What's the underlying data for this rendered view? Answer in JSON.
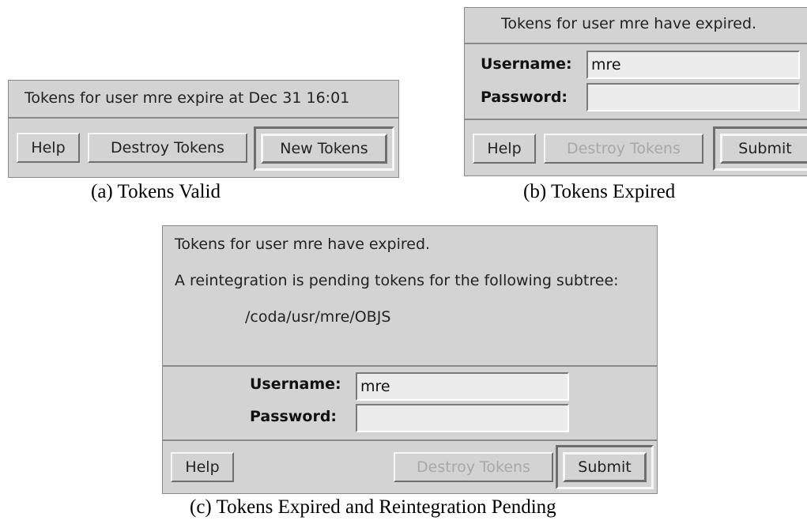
{
  "panel_a": {
    "status": "Tokens for user mre expire at Dec 31 16:01",
    "help_label": "Help",
    "destroy_label": "Destroy Tokens",
    "new_tokens_label": "New Tokens",
    "caption": "(a) Tokens Valid"
  },
  "panel_b": {
    "status": "Tokens for user mre have expired.",
    "username_label": "Username:",
    "username_value": "mre",
    "password_label": "Password:",
    "password_value": "",
    "help_label": "Help",
    "destroy_label": "Destroy Tokens",
    "submit_label": "Submit",
    "caption": "(b) Tokens Expired"
  },
  "panel_c": {
    "status": "Tokens for user mre have expired.",
    "pending_message": "A reintegration is pending tokens for the following subtree:",
    "subtree_path": "/coda/usr/mre/OBJS",
    "username_label": "Username:",
    "username_value": "mre",
    "password_label": "Password:",
    "password_value": "",
    "help_label": "Help",
    "destroy_label": "Destroy Tokens",
    "submit_label": "Submit",
    "caption": "(c) Tokens Expired and Reintegration Pending"
  }
}
